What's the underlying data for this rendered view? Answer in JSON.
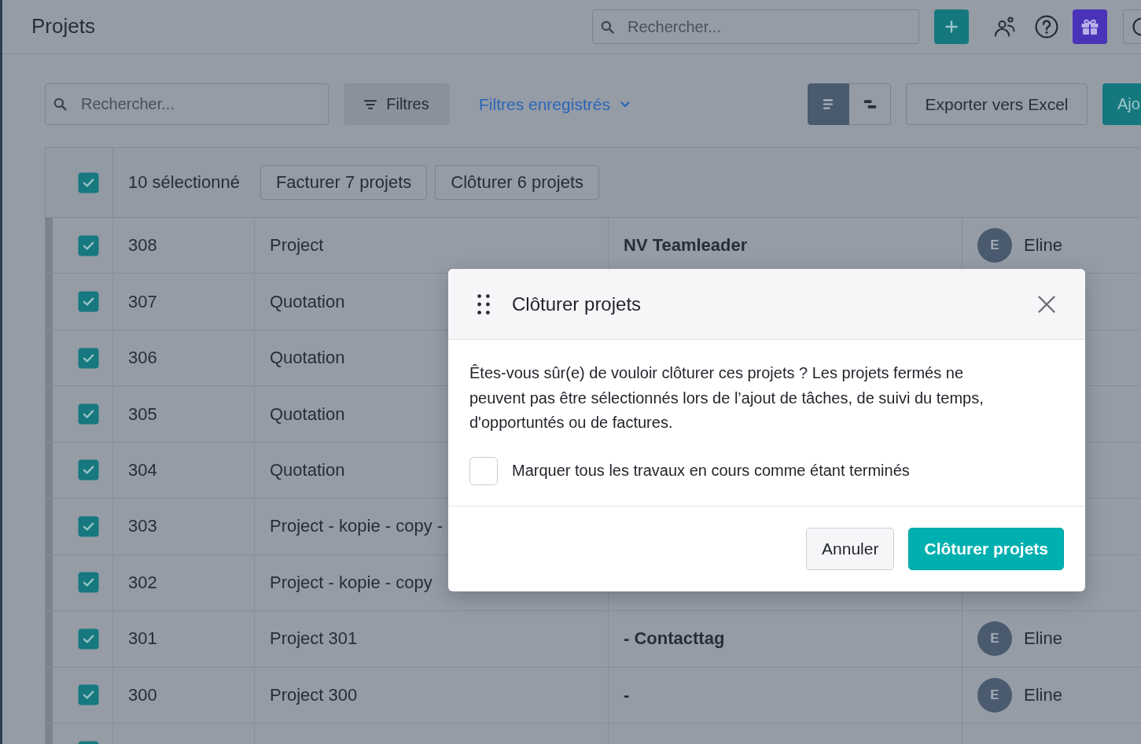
{
  "topbar": {
    "title": "Projets",
    "search": {
      "placeholder": "Rechercher..."
    }
  },
  "toolbar": {
    "search": {
      "placeholder": "Rechercher..."
    },
    "filters_button": "Filtres",
    "saved_filters": "Filtres enregistrés",
    "views": [
      {
        "kind": "list",
        "selected": true
      },
      {
        "kind": "timeline",
        "selected": false
      }
    ],
    "export_button": "Exporter vers Excel",
    "add_button": "Ajo"
  },
  "table": {
    "bulk_bar": {
      "checked": true,
      "count": "10 sélectionné",
      "actions": [
        "Facturer 7 projets",
        "Clôturer 6 projets"
      ]
    },
    "rows": [
      {
        "selected": true,
        "number": "308",
        "name": "Project",
        "column_4": "NV Teamleader",
        "initial": "E",
        "owner": "Eline"
      },
      {
        "selected": true,
        "number": "307",
        "name": "Quotation"
      },
      {
        "selected": true,
        "number": "306",
        "name": "Quotation"
      },
      {
        "selected": true,
        "number": "305",
        "name": "Quotation"
      },
      {
        "selected": true,
        "number": "304",
        "name": "Quotation"
      },
      {
        "selected": true,
        "number": "303",
        "name": "Project - kopie - copy -"
      },
      {
        "selected": true,
        "number": "302",
        "name": "Project - kopie - copy"
      },
      {
        "selected": true,
        "number": "301",
        "name": "Project 301",
        "column_4": "- Contacttag",
        "initial": "E",
        "owner": "Eline"
      },
      {
        "selected": true,
        "number": "300",
        "name": "Project 300",
        "column_4": "-",
        "initial": "E",
        "owner": "Eline"
      },
      {
        "selected": true
      }
    ]
  },
  "dialog": {
    "title": "Clôturer projets",
    "message": "Êtes-vous sûr(e) de vouloir clôturer ces projets ? Les projets fermés ne peuvent pas être sélectionnés lors de l’ajout de tâches, de suivi du temps, d'opportuntés ou de factures.",
    "option": {
      "label": "Marquer tous les travaux en cours comme étant terminés",
      "checked": false
    },
    "buttons": [
      {
        "kind": "secondary",
        "label": "Annuler"
      },
      {
        "kind": "primary",
        "label": "Clôturer projets"
      }
    ]
  }
}
